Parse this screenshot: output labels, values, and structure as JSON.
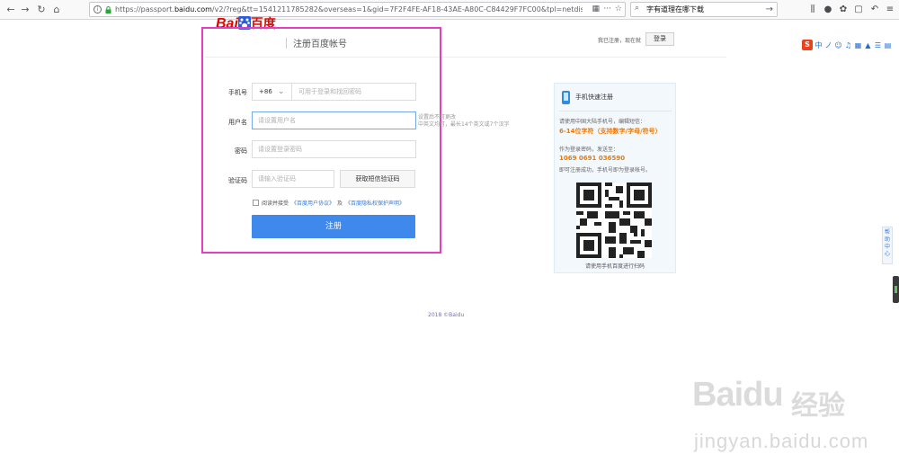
{
  "browser": {
    "url_prefix": "https://passport.",
    "url_host": "baidu.com",
    "url_suffix": "/v2/?reg&tt=1541211785282&overseas=1&gid=7F2F4FE-AF18-43AE-A80C-C84429F7FC00&tpl=netdisk&u=https%3A%",
    "search_value": "字有道理在哪下载"
  },
  "header": {
    "logo_bai": "Bai",
    "logo_du": "百度",
    "title": "注册百度帐号",
    "have_account": "我已注册，现在就",
    "login_button": "登录"
  },
  "ime": {
    "s": "S",
    "items": [
      "中",
      "ノ",
      "☺",
      "♫",
      "▦",
      "▲",
      "☰",
      "▤"
    ]
  },
  "form": {
    "phone_label": "手机号",
    "country_code": "+86",
    "phone_placeholder": "可用于登录和找回密码",
    "username_label": "用户名",
    "username_placeholder": "请设置用户名",
    "username_hint_line1": "设置后不可更改",
    "username_hint_line2": "中英文均可，最长14个英文或7个汉字",
    "password_label": "密码",
    "password_placeholder": "请设置登录密码",
    "captcha_label": "验证码",
    "captcha_placeholder": "请输入验证码",
    "sms_button": "获取短信验证码",
    "agree_prefix": "阅读并接受",
    "agree_link1": "《百度用户协议》",
    "agree_and": "及",
    "agree_link2": "《百度隐私权保护声明》",
    "submit": "注册"
  },
  "side": {
    "title": "手机快速注册",
    "line1": "请使用中国大陆手机号，编辑短信：",
    "line2": "6-14位字符（支持数字/字母/符号）",
    "line3": "作为登录密码，发送至：",
    "line4": "1069 0691 036590",
    "line5": "即可注册成功，手机号即为登录帐号。",
    "qr_caption": "请使用手机百度进行扫码"
  },
  "help_tab": "帮助中心",
  "footer": "2018 ©Baidu",
  "watermark": {
    "brand": "Bai",
    "brand_du": "du",
    "jingyan": "经验",
    "url": "jingyan.baidu.com"
  }
}
